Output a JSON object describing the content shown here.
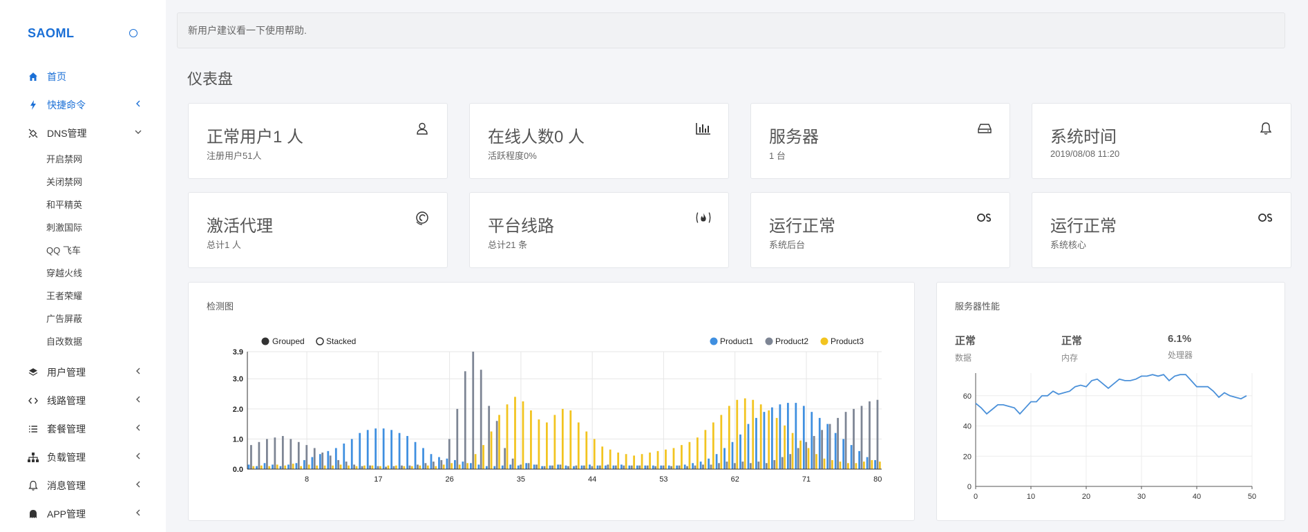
{
  "brand": "SAOML",
  "nav": {
    "home": "首页",
    "quick": "快捷命令",
    "dns": "DNS管理",
    "dns_sub": [
      "开启禁网",
      "关闭禁网",
      "和平精英",
      "刺激国际",
      "QQ 飞车",
      "穿越火线",
      "王者荣耀",
      "广告屏蔽",
      "自改数据"
    ],
    "users": "用户管理",
    "lines": "线路管理",
    "plans": "套餐管理",
    "load": "负载管理",
    "messages": "消息管理",
    "app": "APP管理"
  },
  "notice": "新用户建议看一下使用帮助.",
  "page_title": "仪表盘",
  "cards": [
    {
      "title": "正常用户1 人",
      "sub": "注册用户51人",
      "icon": "user-icon"
    },
    {
      "title": "在线人数0 人",
      "sub": "活跃程度0%",
      "icon": "bar-chart-icon"
    },
    {
      "title": "服务器",
      "sub": "1 台",
      "icon": "hard-drive-icon"
    },
    {
      "title": "系统时间",
      "sub": "2019/08/08 11:20",
      "icon": "bell-icon"
    },
    {
      "title": "激活代理",
      "sub": "总计1 人",
      "icon": "debian-icon"
    },
    {
      "title": "平台线路",
      "sub": "总计21 条",
      "icon": "fire-icon"
    },
    {
      "title": "运行正常",
      "sub": "系统后台",
      "icon": "os-icon"
    },
    {
      "title": "运行正常",
      "sub": "系统核心",
      "icon": "os-icon"
    }
  ],
  "detect": {
    "title": "检测图",
    "mode_grouped": "Grouped",
    "mode_stacked": "Stacked"
  },
  "perf": {
    "title": "服务器性能",
    "stats": [
      {
        "value": "正常",
        "label": "数据"
      },
      {
        "value": "正常",
        "label": "内存"
      },
      {
        "value": "6.1%",
        "label": "处理器"
      }
    ]
  },
  "colors": {
    "accent": "#1a6fd6",
    "product1": "#3f8fe0",
    "product2": "#7d8594",
    "product3": "#f2c420"
  },
  "chart_data": [
    {
      "type": "bar",
      "title": "检测图",
      "x": [
        1,
        2,
        3,
        4,
        5,
        6,
        7,
        8,
        9,
        10,
        11,
        12,
        13,
        14,
        15,
        16,
        17,
        18,
        19,
        20,
        21,
        22,
        23,
        24,
        25,
        26,
        27,
        28,
        29,
        30,
        31,
        32,
        33,
        34,
        35,
        36,
        37,
        38,
        39,
        40,
        41,
        42,
        43,
        44,
        45,
        46,
        47,
        48,
        49,
        50,
        51,
        52,
        53,
        54,
        55,
        56,
        57,
        58,
        59,
        60,
        61,
        62,
        63,
        64,
        65,
        66,
        67,
        68,
        69,
        70,
        71,
        72,
        73,
        74,
        75,
        76,
        77,
        78,
        79,
        80
      ],
      "xticks": [
        8,
        17,
        26,
        35,
        44,
        53,
        62,
        71,
        80
      ],
      "yticks": [
        "0.0",
        "1.0",
        "2.0",
        "3.0",
        "3.9"
      ],
      "ylim": [
        0,
        3.9
      ],
      "legend_placement": "top-right",
      "series": [
        {
          "name": "Product1",
          "values": [
            0.15,
            0.1,
            0.2,
            0.15,
            0.1,
            0.15,
            0.2,
            0.3,
            0.4,
            0.5,
            0.6,
            0.7,
            0.85,
            1.0,
            1.2,
            1.3,
            1.35,
            1.35,
            1.3,
            1.2,
            1.1,
            0.9,
            0.7,
            0.5,
            0.4,
            0.35,
            0.3,
            0.25,
            0.2,
            0.15,
            0.1,
            0.1,
            0.12,
            0.15,
            0.12,
            0.2,
            0.15,
            0.1,
            0.12,
            0.15,
            0.12,
            0.1,
            0.12,
            0.15,
            0.12,
            0.12,
            0.12,
            0.15,
            0.12,
            0.12,
            0.12,
            0.12,
            0.12,
            0.12,
            0.12,
            0.15,
            0.2,
            0.25,
            0.35,
            0.5,
            0.7,
            0.9,
            1.15,
            1.5,
            1.7,
            1.9,
            2.05,
            2.15,
            2.2,
            2.2,
            2.1,
            1.9,
            1.7,
            1.5,
            1.2,
            1.0,
            0.8,
            0.6,
            0.4,
            0.3
          ]
        },
        {
          "name": "Product2",
          "values": [
            0.8,
            0.9,
            1.0,
            1.05,
            1.1,
            1.0,
            0.9,
            0.8,
            0.7,
            0.55,
            0.45,
            0.3,
            0.25,
            0.15,
            0.1,
            0.12,
            0.1,
            0.08,
            0.1,
            0.12,
            0.12,
            0.15,
            0.2,
            0.25,
            0.3,
            1.0,
            2.0,
            3.25,
            3.9,
            3.3,
            2.1,
            1.6,
            0.7,
            0.35,
            0.15,
            0.2,
            0.15,
            0.1,
            0.12,
            0.15,
            0.1,
            0.12,
            0.12,
            0.1,
            0.12,
            0.15,
            0.12,
            0.12,
            0.12,
            0.12,
            0.12,
            0.1,
            0.12,
            0.1,
            0.12,
            0.1,
            0.12,
            0.15,
            0.15,
            0.2,
            0.25,
            0.2,
            0.25,
            0.2,
            0.25,
            0.2,
            0.3,
            0.4,
            0.5,
            0.7,
            0.9,
            1.1,
            1.3,
            1.5,
            1.7,
            1.9,
            2.0,
            2.1,
            2.25,
            2.3
          ]
        },
        {
          "name": "Product3",
          "values": [
            0.1,
            0.12,
            0.1,
            0.15,
            0.12,
            0.18,
            0.1,
            0.15,
            0.12,
            0.12,
            0.12,
            0.15,
            0.12,
            0.1,
            0.12,
            0.12,
            0.1,
            0.12,
            0.12,
            0.1,
            0.1,
            0.12,
            0.12,
            0.1,
            0.15,
            0.2,
            0.15,
            0.2,
            0.5,
            0.8,
            1.25,
            1.8,
            2.15,
            2.4,
            2.25,
            1.95,
            1.65,
            1.55,
            1.8,
            2.0,
            1.95,
            1.55,
            1.25,
            1.0,
            0.75,
            0.65,
            0.55,
            0.5,
            0.45,
            0.5,
            0.55,
            0.6,
            0.65,
            0.7,
            0.8,
            0.9,
            1.05,
            1.3,
            1.55,
            1.8,
            2.1,
            2.3,
            2.35,
            2.3,
            2.15,
            1.95,
            1.7,
            1.45,
            1.2,
            0.95,
            0.7,
            0.5,
            0.35,
            0.3,
            0.25,
            0.2,
            0.2,
            0.25,
            0.3,
            0.25
          ]
        }
      ]
    },
    {
      "type": "line",
      "title": "服务器性能",
      "x": [
        0,
        1,
        2,
        3,
        4,
        5,
        6,
        7,
        8,
        9,
        10,
        11,
        12,
        13,
        14,
        15,
        16,
        17,
        18,
        19,
        20,
        21,
        22,
        23,
        24,
        25,
        26,
        27,
        28,
        29,
        30,
        31,
        32,
        33,
        34,
        35,
        36,
        37,
        38,
        39,
        40,
        41,
        42,
        43,
        44,
        45,
        46,
        47,
        48,
        49
      ],
      "xticks": [
        0,
        10,
        20,
        30,
        40,
        50
      ],
      "yticks": [
        0,
        20,
        40,
        60
      ],
      "xlim": [
        0,
        50
      ],
      "ylim": [
        0,
        75
      ],
      "series": [
        {
          "values": [
            55,
            52,
            48,
            51,
            54,
            54,
            53,
            52,
            48,
            52,
            56,
            56,
            60,
            60,
            63,
            61,
            62,
            63,
            66,
            67,
            66,
            70,
            71,
            68,
            65,
            68,
            71,
            70,
            70,
            71,
            73,
            73,
            74,
            73,
            74,
            70,
            73,
            74,
            74,
            70,
            66,
            66,
            66,
            63,
            59,
            62,
            60,
            59,
            58,
            60
          ]
        }
      ]
    }
  ]
}
